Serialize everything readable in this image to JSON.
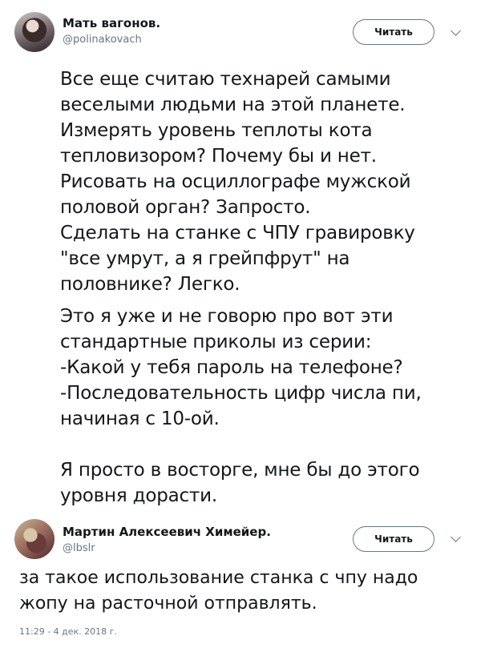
{
  "tweet": {
    "author_name": "Мать вагонов.",
    "author_handle": "@polinakovach",
    "follow_label": "Читать",
    "lines": [
      "Все еще считаю технарей самыми",
      "веселыми людьми на этой планете.",
      "Измерять уровень теплоты кота",
      "тепловизором? Почему бы и нет.",
      "Рисовать на осциллографе мужской",
      "половой орган? Запросто.",
      "Сделать на станке с ЧПУ гравировку",
      "\"все умрут, а я грейпфрут\" на",
      "половнике? Легко.",
      "Это я уже и не говорю про вот эти",
      "стандартные приколы из серии:",
      "-Какой у тебя пароль на телефоне?",
      "-Последовательность цифр числа пи,",
      "начиная с 10-ой.",
      "Я просто в восторге, мне бы до этого",
      "уровня дорасти."
    ]
  },
  "reply": {
    "author_name": "Мартин Алексеевич Химейер.",
    "author_handle": "@lbslr",
    "follow_label": "Читать",
    "lines": [
      "за такое использование станка с чпу надо",
      "жопу на расточной отправлять."
    ],
    "timestamp": "11:29 - 4 дек. 2018 г."
  }
}
